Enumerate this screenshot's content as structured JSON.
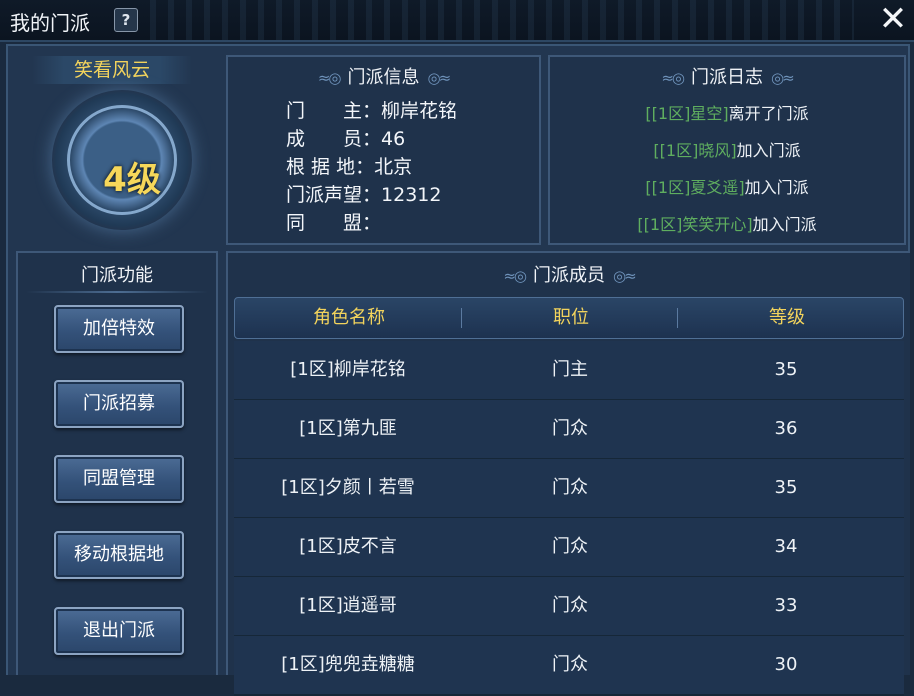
{
  "window": {
    "title": "我的门派",
    "help_label": "?",
    "close_label": "✕"
  },
  "sect": {
    "name": "笑看风云",
    "level": "4级"
  },
  "info": {
    "title": "门派信息",
    "rows": [
      {
        "label": "门　　主：",
        "value": "柳岸花铭"
      },
      {
        "label": "成　　员：",
        "value": "46"
      },
      {
        "label": "根 据 地：",
        "value": "北京"
      },
      {
        "label": "门派声望：",
        "value": "12312"
      },
      {
        "label": "同　　盟：",
        "value": ""
      }
    ]
  },
  "log": {
    "title": "门派日志",
    "items": [
      {
        "name": "[[1区]星空]",
        "action": "离开了门派"
      },
      {
        "name": "[[1区]晓风]",
        "action": "加入门派"
      },
      {
        "name": "[[1区]夏爻遥]",
        "action": "加入门派"
      },
      {
        "name": "[[1区]笑笑开心]",
        "action": "加入门派"
      }
    ]
  },
  "functions": {
    "title": "门派功能",
    "buttons": [
      "加倍特效",
      "门派招募",
      "同盟管理",
      "移动根据地",
      "退出门派"
    ]
  },
  "members": {
    "title": "门派成员",
    "columns": [
      "角色名称",
      "职位",
      "等级"
    ],
    "rows": [
      {
        "name": "[1区]柳岸花铭",
        "role": "门主",
        "level": "35"
      },
      {
        "name": "[1区]第九匪",
        "role": "门众",
        "level": "36"
      },
      {
        "name": "[1区]夕颜丨若雪",
        "role": "门众",
        "level": "35"
      },
      {
        "name": "[1区]皮不言",
        "role": "门众",
        "level": "34"
      },
      {
        "name": "[1区]逍遥哥",
        "role": "门众",
        "level": "33"
      },
      {
        "name": "[1区]兜兜垚糖糖",
        "role": "门众",
        "level": "30"
      }
    ]
  },
  "colors": {
    "gold": "#f2d35c",
    "log_name_green": "#5fae5f",
    "panel": "#1f324b"
  }
}
